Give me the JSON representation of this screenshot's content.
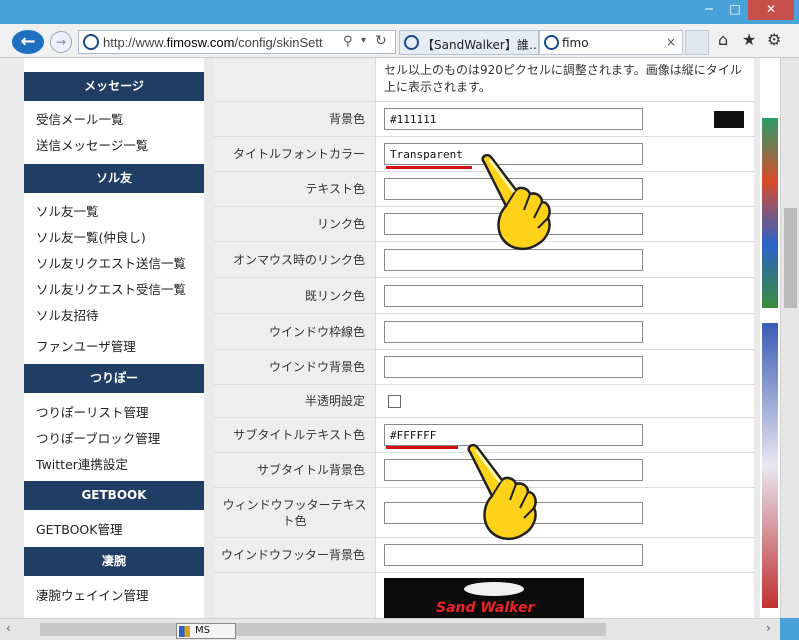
{
  "browser": {
    "window_buttons": {
      "minimize": "─",
      "maximize": "□",
      "close": "✕"
    },
    "back_glyph": "←",
    "forward_glyph": "→",
    "address": {
      "url_prefix": "http://www.",
      "url_domain": "fimosw.com",
      "url_path": "/config/skinSett"
    },
    "tabs": [
      {
        "label": "【SandWalker】誰…",
        "active": false
      },
      {
        "label": "fimo",
        "active": true,
        "close": "×"
      }
    ],
    "toolbar_icons": [
      "home-icon",
      "favorites-star-icon",
      "settings-gear-icon"
    ]
  },
  "sidebar": {
    "sections": [
      {
        "heading": "メッセージ",
        "items": [
          "受信メール一覧",
          "送信メッセージ一覧"
        ]
      },
      {
        "heading": "ソル友",
        "items": [
          "ソル友一覧",
          "ソル友一覧(仲良し)",
          "ソル友リクエスト送信一覧",
          "ソル友リクエスト受信一覧",
          "ソル友招待",
          "ファンユーザ管理"
        ]
      },
      {
        "heading": "つりぽー",
        "items": [
          "つりぽーリスト管理",
          "つりぽーブロック管理",
          "Twitter連携設定"
        ]
      },
      {
        "heading": "GETBOOK",
        "items": [
          "GETBOOK管理"
        ]
      },
      {
        "heading": "凄腕",
        "items": [
          "凄腕ウェイイン管理"
        ]
      }
    ]
  },
  "form": {
    "note": "セル以上のものは920ピクセルに調整されます。画像は縦にタイル上に表示されます。",
    "rows": [
      {
        "label": "背景色",
        "value": "#111111",
        "swatch": "#111111"
      },
      {
        "label": "タイトルフォントカラー",
        "value": "Transparent"
      },
      {
        "label": "テキスト色",
        "value": ""
      },
      {
        "label": "リンク色",
        "value": ""
      },
      {
        "label": "オンマウス時のリンク色",
        "value": ""
      },
      {
        "label": "既リンク色",
        "value": ""
      },
      {
        "label": "ウインドウ枠線色",
        "value": ""
      },
      {
        "label": "ウインドウ背景色",
        "value": ""
      },
      {
        "label": "半透明設定",
        "type": "checkbox",
        "checked": false
      },
      {
        "label": "サブタイトルテキスト色",
        "value": "#FFFFFF",
        "swatch": "#FFFFFF"
      },
      {
        "label": "サブタイトル背景色",
        "value": ""
      },
      {
        "label": "ウィンドウフッターテキスト色",
        "value": ""
      },
      {
        "label": "ウインドウフッター背景色",
        "value": ""
      }
    ],
    "preview_brand": "Sand Walker"
  },
  "taskbar": {
    "label": "MS"
  },
  "colors": {
    "heading_bg": "#203d63",
    "accent_underline": "#d01010",
    "browser_blue": "#4aa3d8"
  }
}
